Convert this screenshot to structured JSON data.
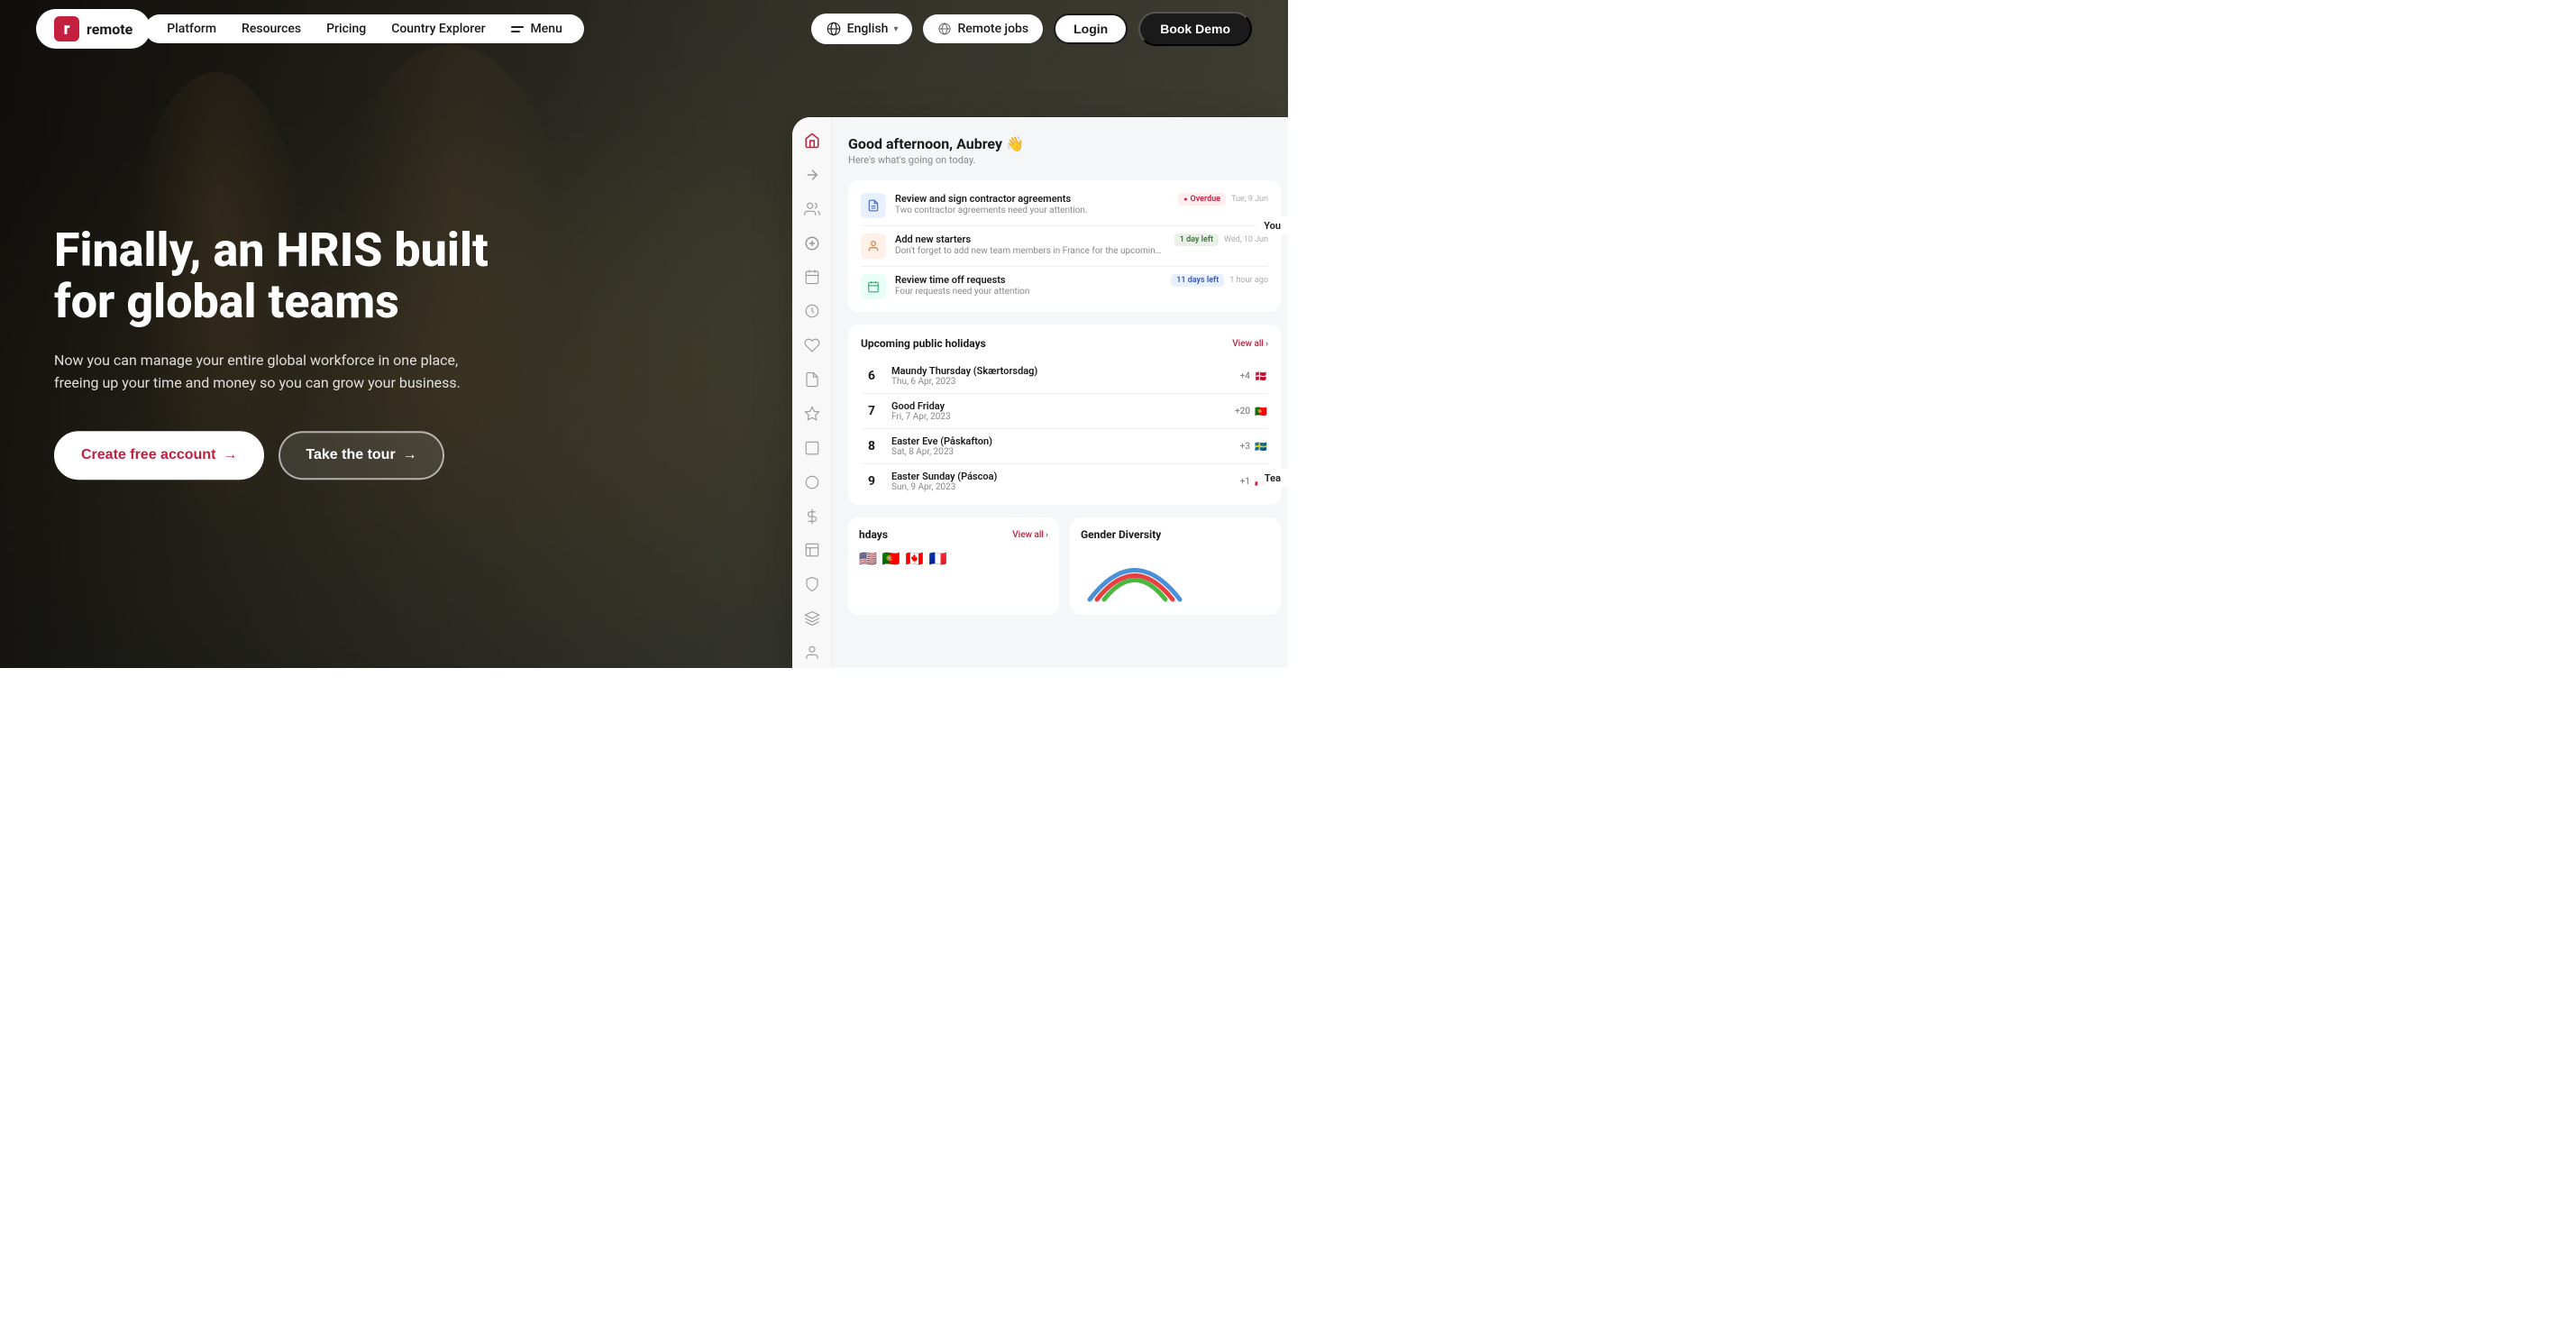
{
  "nav": {
    "logo_letter": "r",
    "logo_text": "remote",
    "links": [
      {
        "id": "platform",
        "label": "Platform"
      },
      {
        "id": "resources",
        "label": "Resources"
      },
      {
        "id": "pricing",
        "label": "Pricing"
      },
      {
        "id": "country-explorer",
        "label": "Country Explorer"
      },
      {
        "id": "menu",
        "label": "Menu"
      }
    ],
    "language": "English",
    "remote_jobs": "Remote jobs",
    "login": "Login",
    "book_demo": "Book Demo"
  },
  "hero": {
    "title_line1": "Finally, an HRIS built",
    "title_line2": "for global teams",
    "subtitle": "Now you can manage your entire global workforce in one place, freeing up your time and money so you can grow your business.",
    "cta_primary": "Create free account",
    "cta_secondary": "Take the tour"
  },
  "dashboard": {
    "greeting": "Good afternoon, Aubrey 👋",
    "subgreeting": "Here's what's going on today.",
    "tasks": [
      {
        "title": "Review and sign contractor agreements",
        "desc": "Two contractor agreements need your attention.",
        "badge_type": "overdue",
        "badge_label": "Overdue",
        "date": "Tue, 9 Jun",
        "icon_type": "blue",
        "icon": "📋"
      },
      {
        "title": "Add new starters",
        "desc": "Don't forget to add new team members in France for the upcoming payroll run.",
        "badge_type": "day",
        "badge_label": "1 day left",
        "date": "Wed, 10 Jun",
        "icon_type": "orange",
        "icon": "👤"
      },
      {
        "title": "Review time off requests",
        "desc": "Four requests need your attention",
        "badge_type": "days11",
        "badge_label": "11 days left",
        "date": "1 hour ago",
        "icon_type": "teal",
        "icon": "📅"
      }
    ],
    "holidays_title": "Upcoming public holidays",
    "holidays_view_all": "View all",
    "holidays": [
      {
        "num": "6",
        "name": "Maundy Thursday (Skærtorsdag)",
        "date": "Thu, 6 Apr, 2023",
        "flag_count": "+4",
        "flags": [
          "🇩🇰"
        ]
      },
      {
        "num": "7",
        "name": "Good Friday",
        "date": "Fri, 7 Apr, 2023",
        "flag_count": "+20",
        "flags": [
          "🇵🇹"
        ]
      },
      {
        "num": "8",
        "name": "Easter Eve (Påskafton)",
        "date": "Sat, 8 Apr, 2023",
        "flag_count": "+3",
        "flags": [
          "🇸🇪"
        ]
      },
      {
        "num": "9",
        "name": "Easter Sunday (Páscoa)",
        "date": "Sun, 9 Apr, 2023",
        "flag_count": "+1",
        "flags": [
          "🇵🇱"
        ]
      }
    ],
    "bottom_section1_title": "hdays",
    "bottom_section1_view_all": "View all",
    "bottom_section2_title": "Gender Diversity",
    "right_label": "You"
  }
}
